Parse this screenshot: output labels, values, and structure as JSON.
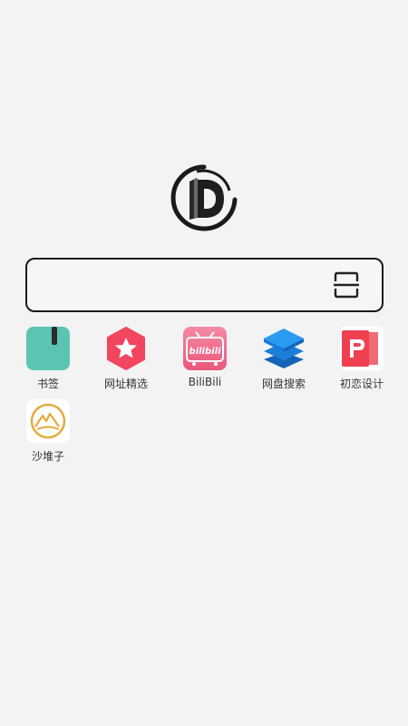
{
  "logo": {
    "icon": "d-book-logo-icon"
  },
  "search": {
    "value": "",
    "placeholder": "",
    "scan_icon": "scan-icon"
  },
  "apps": [
    {
      "label": "书签",
      "icon": "bookmark-icon",
      "color": "#5bc4b3"
    },
    {
      "label": "网址精选",
      "icon": "star-hexagon-icon",
      "color": "#f2455f"
    },
    {
      "label": "BiliBili",
      "icon": "bilibili-icon",
      "color": "#ee6f8c"
    },
    {
      "label": "网盘搜索",
      "icon": "layers-icon",
      "color": "#1f8ae6"
    },
    {
      "label": "初恋设计",
      "icon": "p-design-icon",
      "color": "#ef4050"
    },
    {
      "label": "沙堆子",
      "icon": "sand-mountain-icon",
      "color": "#e7a93c"
    }
  ]
}
